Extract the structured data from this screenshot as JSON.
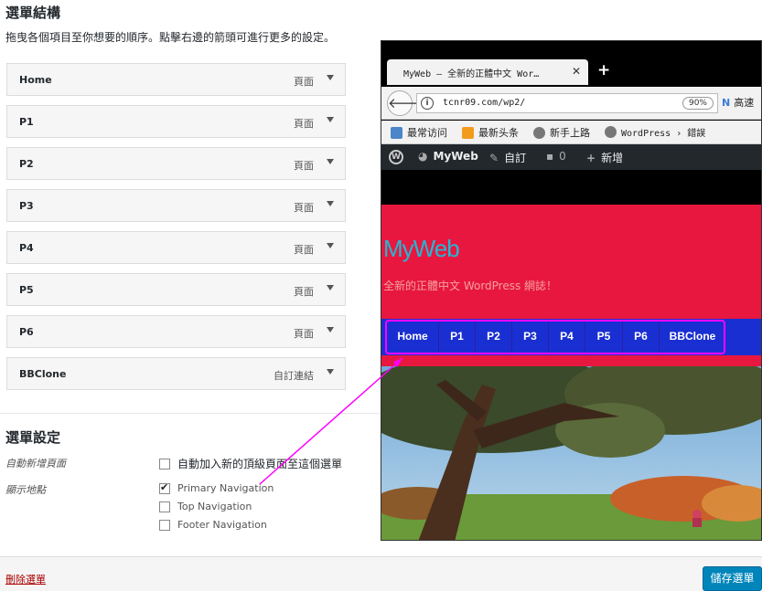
{
  "structure": {
    "heading": "選單結構",
    "description": "拖曳各個項目至你想要的順序。點擊右邊的箭頭可進行更多的設定。"
  },
  "menu_items": [
    {
      "title": "Home",
      "type": "頁面"
    },
    {
      "title": "P1",
      "type": "頁面"
    },
    {
      "title": "P2",
      "type": "頁面"
    },
    {
      "title": "P3",
      "type": "頁面"
    },
    {
      "title": "P4",
      "type": "頁面"
    },
    {
      "title": "P5",
      "type": "頁面"
    },
    {
      "title": "P6",
      "type": "頁面"
    },
    {
      "title": "BBClone",
      "type": "自訂連結"
    }
  ],
  "settings": {
    "heading": "選單設定",
    "auto_add_label": "自動新增頁面",
    "auto_add_text": "自動加入新的頂級頁面至這個選單",
    "auto_add_checked": false,
    "location_label": "顯示地點",
    "locations": [
      {
        "label": "Primary Navigation",
        "checked": true
      },
      {
        "label": "Top Navigation",
        "checked": false
      },
      {
        "label": "Footer Navigation",
        "checked": false
      }
    ]
  },
  "footer": {
    "delete_label": "刪除選單",
    "save_label": "儲存選單"
  },
  "browser": {
    "tab_title": "MyWeb – 全新的正體中文 Wor…",
    "tab_close": "✕",
    "new_tab": "+",
    "back": "🡐",
    "info": "i",
    "url": "tcnr09.com/wp2/",
    "zoom": "90%",
    "search_text": "高速",
    "bookmarks": [
      "最常访问",
      "最新头条",
      "新手上路",
      "WordPress › 錯誤"
    ],
    "admin_bar": {
      "wp": "W",
      "site": "MyWeb",
      "customize": "自訂",
      "comments": "0",
      "new": "新增"
    }
  },
  "site": {
    "title": "MyWeb",
    "description": "全新的正體中文 WordPress 網誌！",
    "nav": [
      "Home",
      "P1",
      "P2",
      "P3",
      "P4",
      "P5",
      "P6",
      "BBClone"
    ]
  },
  "colors": {
    "header_red": "#e8173f",
    "nav_blue": "#1a2fd1",
    "highlight_magenta": "#ff00ff",
    "save_blue": "#0085ba"
  }
}
